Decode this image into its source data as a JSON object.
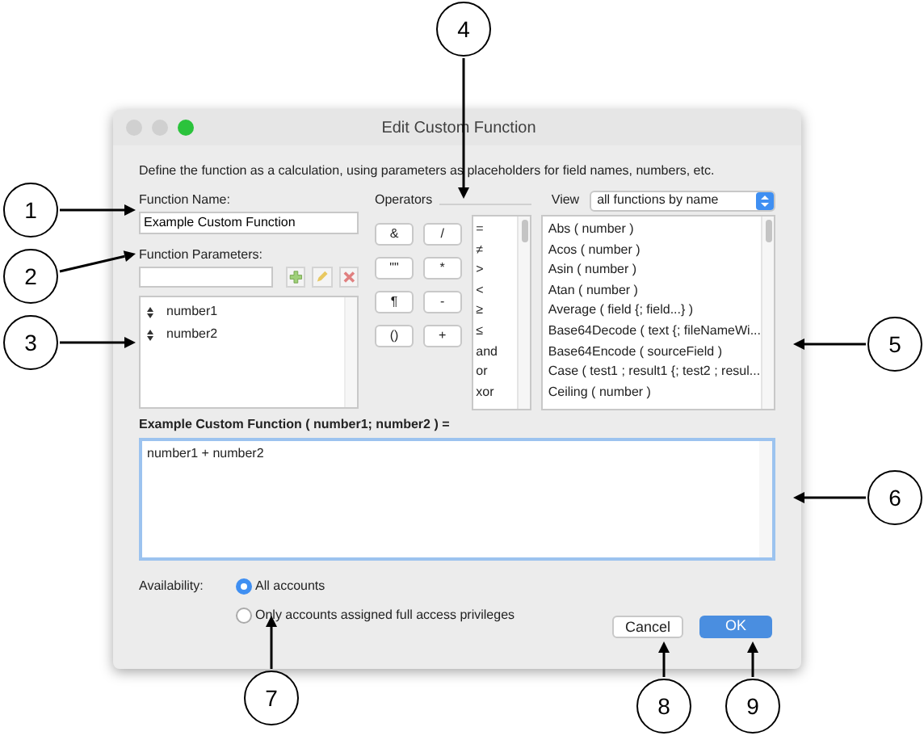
{
  "window": {
    "title": "Edit Custom Function"
  },
  "description": "Define the function as a calculation, using parameters as placeholders for field names, numbers, etc.",
  "function_name": {
    "label": "Function Name:",
    "value": "Example Custom Function"
  },
  "function_parameters": {
    "label": "Function Parameters:",
    "items": [
      {
        "name": "number1"
      },
      {
        "name": "number2"
      }
    ]
  },
  "operators": {
    "label": "Operators",
    "buttons": [
      "&",
      "/",
      "\"\"",
      "*",
      "¶",
      "-",
      "()",
      "+"
    ],
    "list": [
      "=",
      "≠",
      ">",
      "<",
      "≥",
      "≤",
      "and",
      "or",
      "xor"
    ]
  },
  "view": {
    "label": "View",
    "value": "all functions by name"
  },
  "functions": [
    "Abs ( number )",
    "Acos ( number )",
    "Asin ( number )",
    "Atan ( number )",
    "Average ( field {; field...} )",
    "Base64Decode ( text {; fileNameWi...",
    "Base64Encode ( sourceField )",
    "Case ( test1 ; result1 {; test2 ; resul...",
    "Ceiling ( number )"
  ],
  "formula": {
    "label": "Example Custom Function ( number1; number2 ) =",
    "value": "number1 + number2"
  },
  "availability": {
    "label": "Availability:",
    "options": [
      {
        "label": "All accounts",
        "selected": true
      },
      {
        "label": "Only accounts assigned full access privileges",
        "selected": false
      }
    ]
  },
  "buttons": [
    {
      "label": "Cancel",
      "kind": "secondary"
    },
    {
      "label": "OK",
      "kind": "default"
    }
  ],
  "callouts": [
    "1",
    "2",
    "3",
    "4",
    "5",
    "6",
    "7",
    "8",
    "9"
  ]
}
